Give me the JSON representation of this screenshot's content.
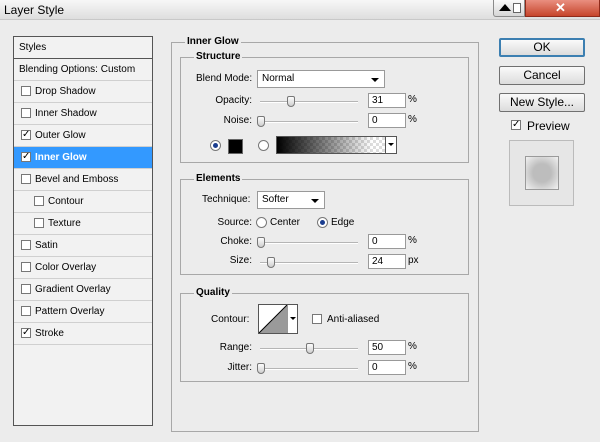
{
  "window": {
    "title": "Layer Style"
  },
  "styles_panel": {
    "header": "Styles",
    "items": [
      {
        "label": "Blending Options: Custom",
        "checkbox": false,
        "checked": false,
        "indent": false,
        "selected": false
      },
      {
        "label": "Drop Shadow",
        "checkbox": true,
        "checked": false,
        "indent": false,
        "selected": false
      },
      {
        "label": "Inner Shadow",
        "checkbox": true,
        "checked": false,
        "indent": false,
        "selected": false
      },
      {
        "label": "Outer Glow",
        "checkbox": true,
        "checked": true,
        "indent": false,
        "selected": false
      },
      {
        "label": "Inner Glow",
        "checkbox": true,
        "checked": true,
        "indent": false,
        "selected": true
      },
      {
        "label": "Bevel and Emboss",
        "checkbox": true,
        "checked": false,
        "indent": false,
        "selected": false
      },
      {
        "label": "Contour",
        "checkbox": true,
        "checked": false,
        "indent": true,
        "selected": false
      },
      {
        "label": "Texture",
        "checkbox": true,
        "checked": false,
        "indent": true,
        "selected": false
      },
      {
        "label": "Satin",
        "checkbox": true,
        "checked": false,
        "indent": false,
        "selected": false
      },
      {
        "label": "Color Overlay",
        "checkbox": true,
        "checked": false,
        "indent": false,
        "selected": false
      },
      {
        "label": "Gradient Overlay",
        "checkbox": true,
        "checked": false,
        "indent": false,
        "selected": false
      },
      {
        "label": "Pattern Overlay",
        "checkbox": true,
        "checked": false,
        "indent": false,
        "selected": false
      },
      {
        "label": "Stroke",
        "checkbox": true,
        "checked": true,
        "indent": false,
        "selected": false
      }
    ]
  },
  "inner_glow": {
    "title": "Inner Glow",
    "structure": {
      "title": "Structure",
      "blend_mode_label": "Blend Mode:",
      "blend_mode_value": "Normal",
      "opacity_label": "Opacity:",
      "opacity_value": "31",
      "opacity_unit": "%",
      "opacity_fraction": 0.31,
      "noise_label": "Noise:",
      "noise_value": "0",
      "noise_unit": "%",
      "noise_fraction": 0,
      "color": "#000000",
      "color_mode_selected": "solid"
    },
    "elements": {
      "title": "Elements",
      "technique_label": "Technique:",
      "technique_value": "Softer",
      "source_label": "Source:",
      "source_center": "Center",
      "source_edge": "Edge",
      "source_selected": "edge",
      "choke_label": "Choke:",
      "choke_value": "0",
      "choke_unit": "%",
      "choke_fraction": 0,
      "size_label": "Size:",
      "size_value": "24",
      "size_unit": "px",
      "size_fraction": 0.1
    },
    "quality": {
      "title": "Quality",
      "contour_label": "Contour:",
      "anti_aliased_label": "Anti-aliased",
      "anti_aliased": false,
      "range_label": "Range:",
      "range_value": "50",
      "range_unit": "%",
      "range_fraction": 0.5,
      "jitter_label": "Jitter:",
      "jitter_value": "0",
      "jitter_unit": "%",
      "jitter_fraction": 0
    }
  },
  "buttons": {
    "ok": "OK",
    "cancel": "Cancel",
    "new_style": "New Style..."
  },
  "preview": {
    "label": "Preview",
    "checked": true
  },
  "colors": {
    "selection": "#3399ff",
    "ok_border": "#3c7fb1",
    "close_button": "#c6452b"
  }
}
